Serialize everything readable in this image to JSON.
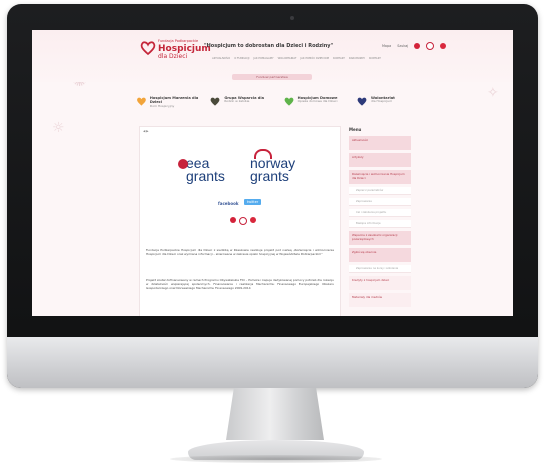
{
  "header": {
    "logo_small": "Fundacja Podkarpackie",
    "logo_big": "Hospicjum",
    "logo_sub": "dla Dzieci",
    "motto": "\"Hospicjum to dobrostan dla Dzieci i Rodziny\"",
    "nav": [
      "Aktualności",
      "O fundacji",
      "Jak pomagamy",
      "Wolontariat",
      "Jak pomóc dzieciom",
      "Kontakt",
      "Darowizny",
      "Kontakt"
    ],
    "utility": [
      "Mapa",
      "Szukaj"
    ],
    "flags": [
      "#d3233a",
      "#c7223b",
      "#d9283d"
    ]
  },
  "ribbon": "Fundusz partnerstwa",
  "partners": [
    {
      "title": "Hospicjum Marzenia dla Dzieci",
      "sub": "Dom Hospicyjny",
      "color": "#f2a43a"
    },
    {
      "title": "Grupa Wsparcia dla",
      "sub": "Rodzin w żałobie",
      "color": "#4a4a3a"
    },
    {
      "title": "Hospicjum Domowe",
      "sub": "Opieka domowa dla Dzieci",
      "color": "#5fb34a"
    },
    {
      "title": "Wolontariat",
      "sub": "dla Hospicjum",
      "color": "#2e3a7a"
    }
  ],
  "content": {
    "crumb": "◀ ▶",
    "eea": [
      "eea",
      "grants"
    ],
    "norway": [
      "norway",
      "grants"
    ],
    "facebook": "facebook",
    "twitter": "twitter",
    "paragraph1": "Fundacja Podkarpackie Hospicjum dla Dzieci z siedzibą w Rzeszowie realizuje projekt pod nazwą „Rozwinięcie i wzmocnienie Hospicjum dla Dzieci oraz wymiana informacji – skierowane w zakresie opieki hospicyjnej w Województwie Podkarpackim”",
    "paragraph2": "Projekt został dofinansowany w ramach Programu Obywatelskie FIO – Pomoże i kapuje dedykowanej pomocy potrzeb dla rozwoju w działalności wspierającej społecznych. Finansowanie i realizacja Mechanizmu Finansowego Europejskiego Obszaru Gospodarczego oraz Norweskiego Mechanizmu Finansowego 2009-2014"
  },
  "sidebar": {
    "title": "Menu",
    "items": [
      {
        "label": "Aktualności",
        "kind": "item"
      },
      {
        "label": "Artykuły",
        "kind": "item"
      },
      {
        "label": "Rozwinięcie i wzmocnienie Hospicjum dla Dzieci",
        "kind": "item"
      },
      {
        "label": "Zapisz z parametrów",
        "kind": "sub"
      },
      {
        "label": "Zaproszenie",
        "kind": "sub"
      },
      {
        "label": "Cel i założenia projektu",
        "kind": "sub"
      },
      {
        "label": "Bieżące informacje",
        "kind": "sub"
      },
      {
        "label": "Wsparcie z zasobami organizacji pozarządowych",
        "kind": "item"
      },
      {
        "label": "Zgłoś się obecnie",
        "kind": "item"
      },
      {
        "label": "Zaproszenie na kursy i szkolenia",
        "kind": "sub"
      },
      {
        "label": "Kredyty z hospicjum dzieci",
        "kind": "light"
      },
      {
        "label": "Materiały dla mediów",
        "kind": "light"
      }
    ]
  }
}
